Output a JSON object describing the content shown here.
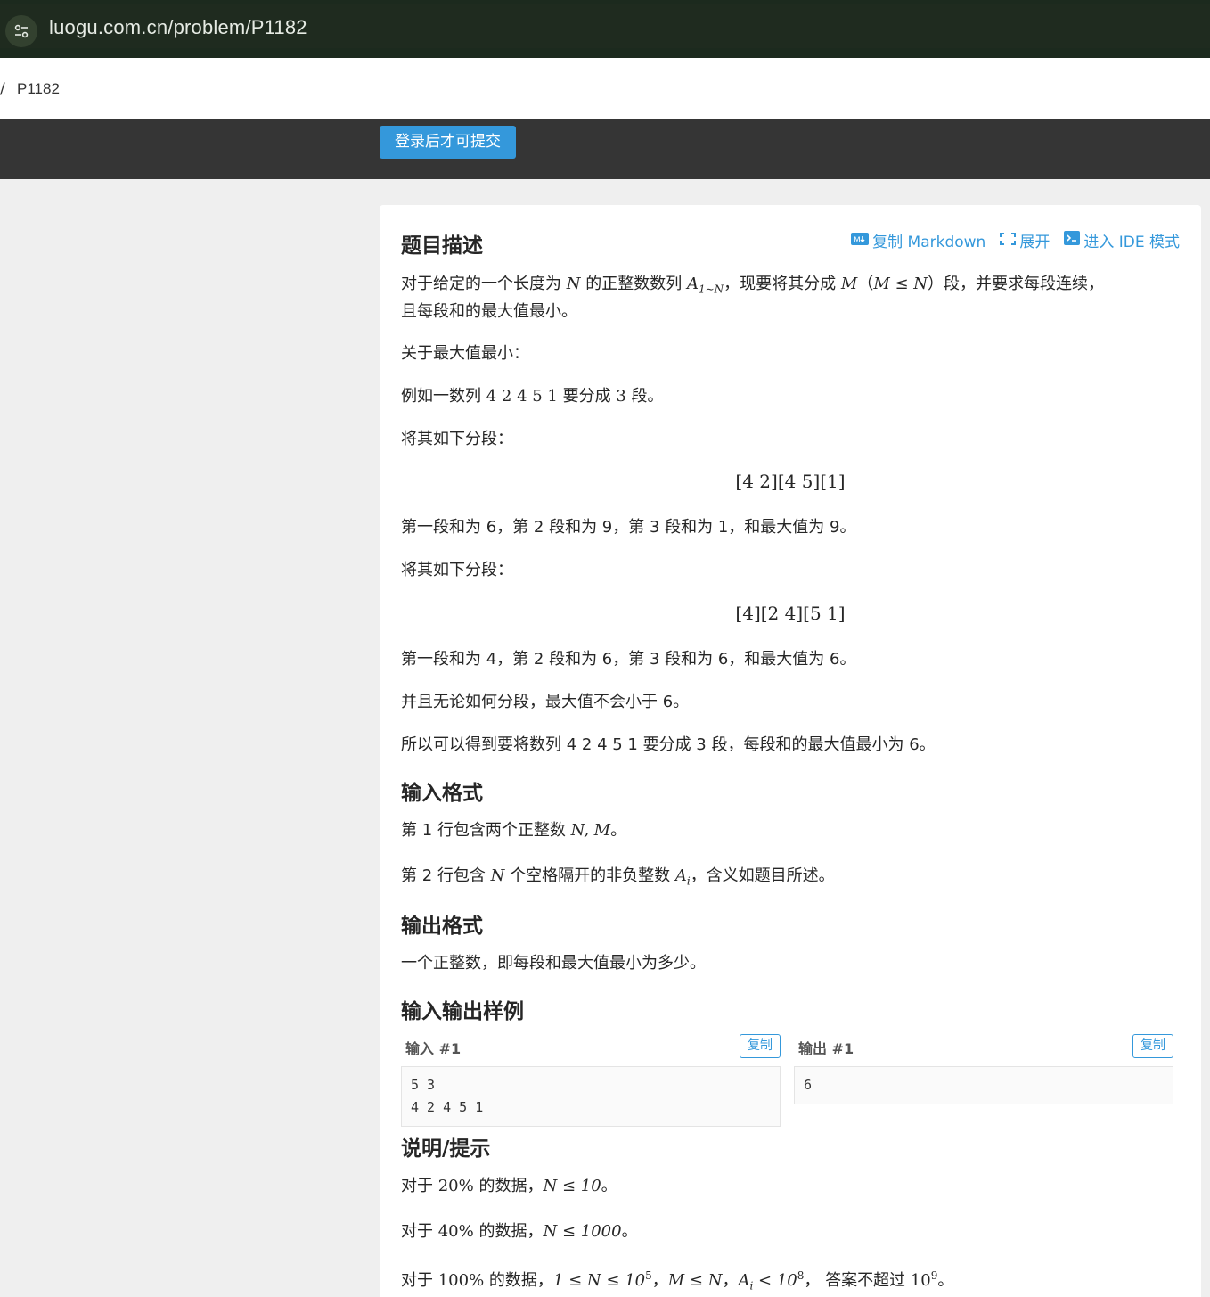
{
  "browser": {
    "url": "luogu.com.cn/problem/P1182"
  },
  "breadcrumb": {
    "separator": "/",
    "problem_id": "P1182"
  },
  "header": {
    "submit_label": "登录后才可提交"
  },
  "toolbar": {
    "copy_markdown": "复制 Markdown",
    "expand": "展开",
    "ide_mode": "进入 IDE 模式"
  },
  "description": {
    "title": "题目描述",
    "p1_a": "对于给定的一个长度为 ",
    "p1_N": "N",
    "p1_b": " 的正整数数列 ",
    "p1_A": "A",
    "p1_sub": "1∼N",
    "p1_c": "，现要将其分成 ",
    "p1_M": "M",
    "p1_d": "（",
    "p1_cond": "M ≤ N",
    "p1_e": "）段，并要求每段连续，",
    "p1_line2": "且每段和的最大值最小。",
    "p2": "关于最大值最小：",
    "p3_a": "例如一数列 ",
    "p3_seq": "4 2 4 5 1",
    "p3_b": " 要分成 ",
    "p3_k": "3",
    "p3_c": " 段。",
    "p4": "将其如下分段：",
    "split1": "[4 2][4 5][1]",
    "p5": "第一段和为 6，第 2 段和为 9，第 3 段和为 1，和最大值为 9。",
    "p6": "将其如下分段：",
    "split2": "[4][2 4][5 1]",
    "p7": "第一段和为 4，第 2 段和为 6，第 3 段和为 6，和最大值为 6。",
    "p8": "并且无论如何分段，最大值不会小于 6。",
    "p9": "所以可以得到要将数列 4 2 4 5 1 要分成 3 段，每段和的最大值最小为 6。"
  },
  "input_format": {
    "title": "输入格式",
    "l1_a": "第 1 行包含两个正整数 ",
    "l1_m": "N, M",
    "l1_b": "。",
    "l2_a": "第 2 行包含 ",
    "l2_N": "N",
    "l2_b": " 个空格隔开的非负整数 ",
    "l2_A": "A",
    "l2_sub": "i",
    "l2_c": "，含义如题目所述。"
  },
  "output_format": {
    "title": "输出格式",
    "text": "一个正整数，即每段和最大值最小为多少。"
  },
  "samples": {
    "title": "输入输出样例",
    "input_label": "输入 #1",
    "output_label": "输出 #1",
    "copy_label": "复制",
    "input_text": "5 3\n4 2 4 5 1",
    "output_text": "6"
  },
  "hints": {
    "title": "说明/提示",
    "h1_a": "对于 ",
    "h1_pct": "20%",
    "h1_b": " 的数据，",
    "h1_m": "N ≤ 10",
    "h1_c": "。",
    "h2_a": "对于 ",
    "h2_pct": "40%",
    "h2_b": " 的数据，",
    "h2_m": "N ≤ 1000",
    "h2_c": "。",
    "h3_a": "对于 ",
    "h3_pct": "100%",
    "h3_b": " 的数据，",
    "h3_m1": "1 ≤ N ≤ 10",
    "h3_e1": "5",
    "h3_c": "，",
    "h3_m2": "M ≤ N",
    "h3_d": "，",
    "h3_m3": "A",
    "h3_m3sub": "i",
    "h3_m3b": " < 10",
    "h3_e3": "8",
    "h3_e": "， 答案不超过 ",
    "h3_m4": "10",
    "h3_e4": "9",
    "h3_f": "。"
  },
  "colors": {
    "accent": "#3498db",
    "header_dark": "#353535",
    "browser_bar": "#1f2b1f"
  }
}
